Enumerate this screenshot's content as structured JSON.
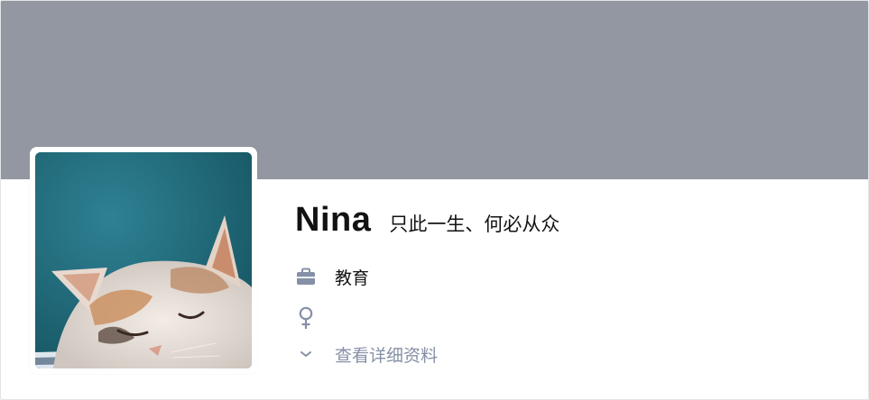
{
  "profile": {
    "name": "Nina",
    "headline": "只此一生、何必从众",
    "industry": "教育",
    "gender_icon": "female-icon",
    "industry_icon": "briefcase-icon",
    "expand_icon": "chevron-down-icon",
    "more_label": "查看详细资料"
  },
  "colors": {
    "cover": "#9297a1",
    "icon": "#8590a6",
    "text": "#121212",
    "muted": "#8590a6"
  },
  "avatar": {
    "subject": "cat-photo"
  }
}
